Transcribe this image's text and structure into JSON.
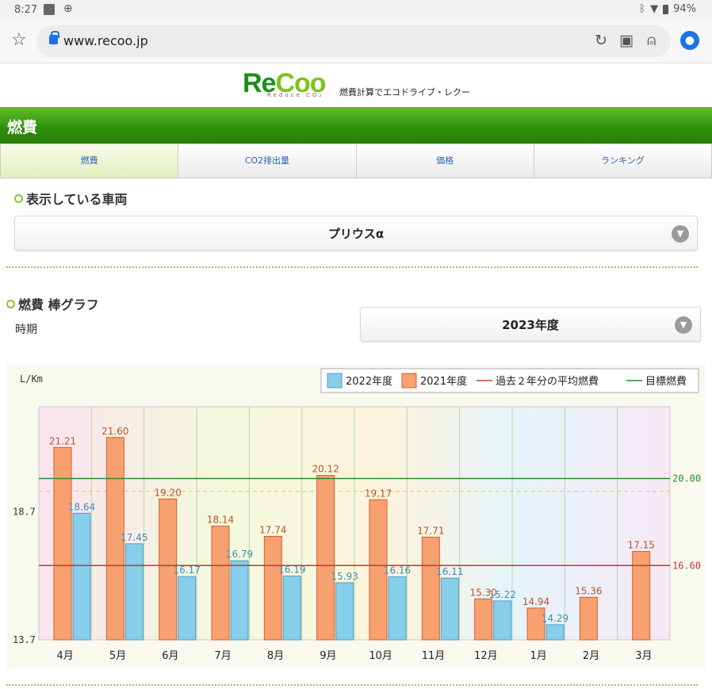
{
  "status": {
    "time": "8:27",
    "battery": "94%"
  },
  "browser": {
    "url": "www.recoo.jp"
  },
  "site": {
    "logo": "ReCoo",
    "logo_sub": "Reduce CO₂",
    "tagline": "燃費計算でエコドライブ・レクー"
  },
  "title": "燃費",
  "tabs": [
    {
      "label": "燃費"
    },
    {
      "label": "CO2排出量"
    },
    {
      "label": "価格"
    },
    {
      "label": "ランキング"
    }
  ],
  "vehicle": {
    "heading": "表示している車両",
    "selected": "プリウスα"
  },
  "graph": {
    "heading": "燃費 棒グラフ",
    "period_label": "時期",
    "period_selected": "2023年度"
  },
  "icons": {
    "star": "star-icon",
    "lock": "lock-icon",
    "reload": "reload-icon",
    "camera": "camera-icon",
    "mic": "mic-icon",
    "account": "account-icon",
    "chevron": "chevron-down-icon"
  },
  "colors": {
    "green": "#2f8e0c",
    "series2022": "#87ceeb",
    "series2021": "#f7a070",
    "avg": "#cc3333",
    "target": "#2e8b2e"
  },
  "chart_data": {
    "type": "bar",
    "ylabel": "L/Km",
    "ylim": [
      13.7,
      22.8
    ],
    "y_ticks": [
      13.7,
      18.7
    ],
    "categories": [
      "4月",
      "5月",
      "6月",
      "7月",
      "8月",
      "9月",
      "10月",
      "11月",
      "12月",
      "1月",
      "2月",
      "3月"
    ],
    "series": [
      {
        "name": "2022年度",
        "values": [
          18.64,
          17.45,
          16.17,
          16.79,
          16.19,
          15.93,
          16.16,
          16.11,
          15.22,
          14.29,
          null,
          null
        ]
      },
      {
        "name": "2021年度",
        "values": [
          21.21,
          21.6,
          19.2,
          18.14,
          17.74,
          20.12,
          19.17,
          17.71,
          15.3,
          14.94,
          15.36,
          17.15
        ]
      }
    ],
    "lines": [
      {
        "name": "過去２年分の平均燃費",
        "value": 16.6,
        "label": "16.60"
      },
      {
        "name": "目標燃費",
        "value": 20.0,
        "label": "20.00"
      }
    ],
    "legend_position": "top-right"
  }
}
